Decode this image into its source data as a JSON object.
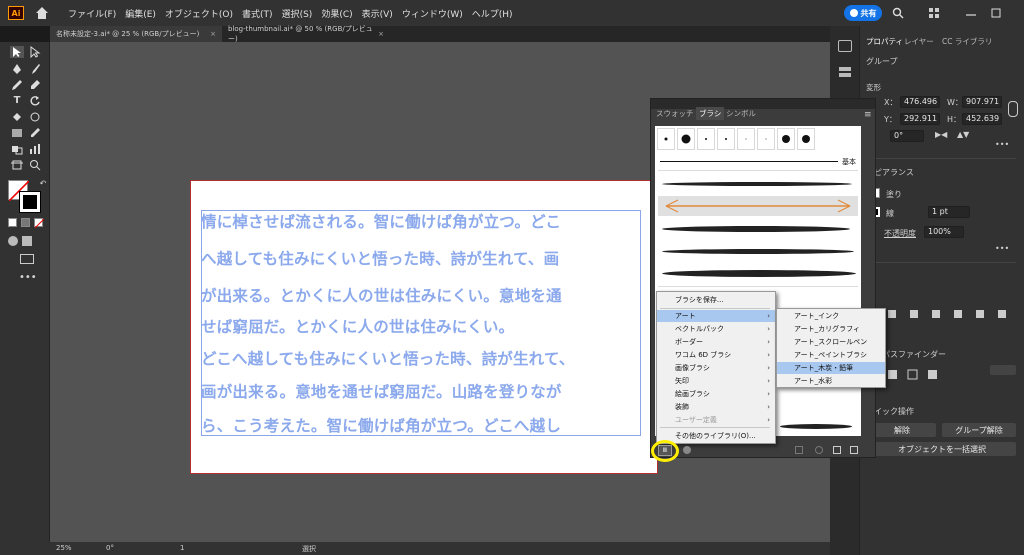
{
  "app": {
    "logo_text": "Ai",
    "menus": [
      "ファイル(F)",
      "編集(E)",
      "オブジェクト(O)",
      "書式(T)",
      "選択(S)",
      "効果(C)",
      "表示(V)",
      "ウィンドウ(W)",
      "ヘルプ(H)"
    ],
    "share_label": "共有"
  },
  "tabs": [
    {
      "label": "名称未設定-3.ai* @ 25 % (RGB/プレビュー)",
      "close": "×"
    },
    {
      "label": "blog-thumbnail.ai* @ 50 % (RGB/プレビュー)",
      "close": "×"
    }
  ],
  "canvas": {
    "text_lines": [
      "情に棹させば流される。智に働けば角が立つ。どこ",
      "へ越しても住みにくいと悟った時、詩が生れて、画",
      "が出来る。とかくに人の世は住みにくい。意地を通",
      "せば窮屈だ。とかくに人の世は住みにくい。",
      "どこへ越しても住みにくいと悟った時、詩が生れて、",
      "画が出来る。意地を通せば窮屈だ。山路を登りなが",
      "ら、こう考えた。智に働けば角が立つ。どこへ越し"
    ]
  },
  "brush_panel": {
    "tabs": [
      "スウォッチ",
      "ブラシ",
      "シンボル"
    ],
    "basic_label": "基本"
  },
  "context_menu": {
    "items": [
      {
        "label": "ブラシを保存...",
        "submenu": false
      },
      {
        "label": "アート",
        "submenu": true
      },
      {
        "label": "ベクトルパック",
        "submenu": true
      },
      {
        "label": "ボーダー",
        "submenu": true
      },
      {
        "label": "ワコム 6D ブラシ",
        "submenu": true
      },
      {
        "label": "画像ブラシ",
        "submenu": true
      },
      {
        "label": "矢印",
        "submenu": true
      },
      {
        "label": "絵画ブラシ",
        "submenu": true
      },
      {
        "label": "装飾",
        "submenu": true
      },
      {
        "label": "ユーザー定義",
        "submenu": true
      },
      {
        "label": "その他のライブラリ(O)...",
        "submenu": false
      }
    ],
    "submenu_items": [
      "アート_インク",
      "アート_カリグラフィ",
      "アート_スクロールペン",
      "アート_ペイントブラシ",
      "アート_木炭・鉛筆",
      "アート_水彩"
    ],
    "highlighted_submenu": "アート_木炭・鉛筆"
  },
  "properties": {
    "tabs": [
      "プロパティ",
      "レイヤー",
      "CC ライブラリ"
    ],
    "group_label": "グループ",
    "transform_label": "変形",
    "x_label": "X：",
    "x_value": "476.496",
    "w_label": "W：",
    "w_value": "907.971",
    "y_label": "Y：",
    "y_value": "292.911",
    "h_label": "H：",
    "h_value": "452.639",
    "angle_value": "0°",
    "appearance_label": "アピアランス",
    "fill_label": "塗り",
    "stroke_label": "線",
    "stroke_value": "1 pt",
    "opacity_label": "不透明度",
    "opacity_value": "100%",
    "pathfinder_label": "パスファインダー",
    "quick_actions_label": "クイック操作",
    "release_label": "解除",
    "ungroup_label": "グループ解除",
    "select_similar_label": "オブジェクトを一括選択"
  },
  "status": {
    "zoom": "25%",
    "rotate": "0°",
    "artboard": "1",
    "mode": "選択"
  },
  "colors": {
    "accent": "#1473e6",
    "text_blue": "#8ba9ec",
    "highlight": "#ffee00"
  }
}
